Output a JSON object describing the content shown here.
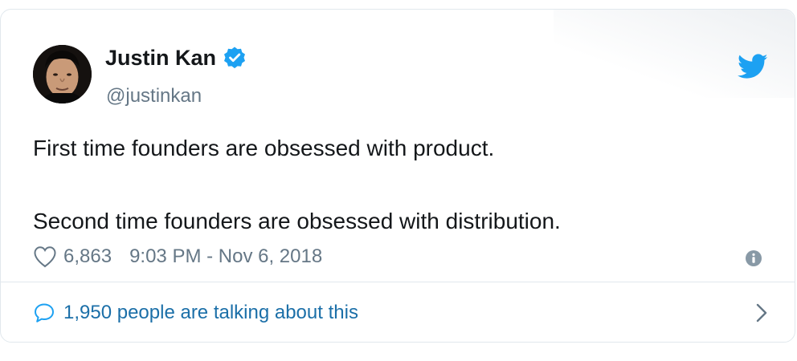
{
  "author": {
    "name": "Justin Kan",
    "handle": "@justinkan",
    "verified": true,
    "avatar": "avatar-photo"
  },
  "tweet": {
    "lines": [
      "First time founders are obsessed with product.",
      "Second time founders are obsessed with distribution."
    ]
  },
  "meta": {
    "likes": "6,863",
    "timestamp": "9:03 PM - Nov 6, 2018"
  },
  "talking": {
    "label": "1,950 people are talking about this"
  },
  "icons": {
    "brand": "twitter-bird-icon",
    "verified": "verified-badge-icon",
    "like": "heart-icon",
    "info": "info-icon",
    "conversation": "speech-bubble-icon",
    "expand": "chevron-right-icon"
  },
  "colors": {
    "brand_blue": "#1da1f2",
    "verified_blue": "#1da1f2",
    "text": "#14171a",
    "secondary": "#657786",
    "link": "#1b6fa8",
    "border": "#e1e8ed"
  }
}
